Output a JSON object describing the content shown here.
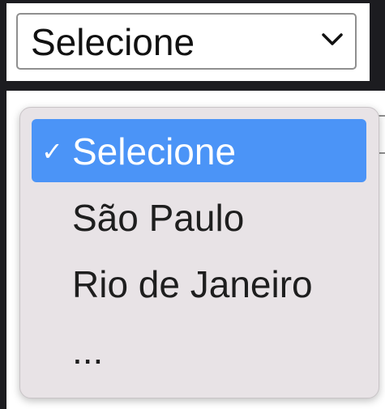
{
  "select": {
    "value": "Selecione"
  },
  "dropdown": {
    "options": [
      {
        "label": "Selecione",
        "selected": true
      },
      {
        "label": "São Paulo",
        "selected": false
      },
      {
        "label": "Rio de Janeiro",
        "selected": false
      },
      {
        "label": "...",
        "selected": false
      }
    ],
    "checkmark": "✓",
    "highlight_color": "#4b94f7",
    "menu_background": "#e8e3e6"
  },
  "icons": {
    "select_indicator": "chevron-down-icon",
    "selected_indicator": "checkmark-icon"
  }
}
